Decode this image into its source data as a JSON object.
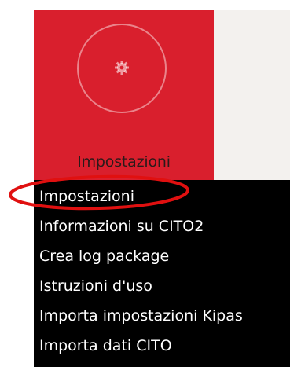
{
  "tile": {
    "label": "Impostazioni",
    "icon": "gear-icon",
    "color": "#d91f2d"
  },
  "menu": {
    "items": [
      {
        "label": "Impostazioni"
      },
      {
        "label": "Informazioni su CITO2"
      },
      {
        "label": "Crea log package"
      },
      {
        "label": "Istruzioni d'uso"
      },
      {
        "label": "Importa impostazioni Kipas"
      },
      {
        "label": "Importa dati CITO"
      }
    ]
  },
  "annotation": {
    "highlight_color": "#e01010",
    "highlighted_item": "Impostazioni"
  }
}
